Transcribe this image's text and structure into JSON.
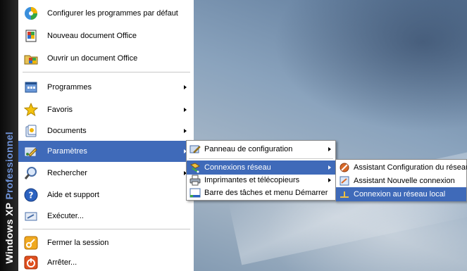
{
  "os_brand": {
    "os_name": "Windows XP",
    "edition": "Professionnel"
  },
  "start_menu": {
    "items": [
      {
        "label": "Configurer les programmes par défaut",
        "icon": "default-programs-icon"
      },
      {
        "label": "Nouveau document Office",
        "icon": "new-office-document-icon"
      },
      {
        "label": "Ouvrir un document Office",
        "icon": "open-office-document-icon"
      },
      {
        "label": "Programmes",
        "icon": "programs-icon"
      },
      {
        "label": "Favoris",
        "icon": "favorites-star-icon"
      },
      {
        "label": "Documents",
        "icon": "documents-icon"
      },
      {
        "label": "Paramètres",
        "icon": "settings-icon"
      },
      {
        "label": "Rechercher",
        "icon": "search-magnifier-icon"
      },
      {
        "label": "Aide et support",
        "icon": "help-icon"
      },
      {
        "label": "Exécuter...",
        "icon": "run-icon"
      },
      {
        "label": "Fermer la session",
        "icon": "logoff-key-icon"
      },
      {
        "label": "Arrêter...",
        "icon": "shutdown-icon"
      }
    ]
  },
  "settings_submenu": {
    "items": [
      {
        "label": "Panneau de configuration",
        "icon": "control-panel-icon"
      },
      {
        "label": "Connexions réseau",
        "icon": "network-connections-icon"
      },
      {
        "label": "Imprimantes et télécopieurs",
        "icon": "printers-icon"
      },
      {
        "label": "Barre des tâches et menu Démarrer",
        "icon": "taskbar-icon"
      }
    ]
  },
  "network_submenu": {
    "items": [
      {
        "label": "Assistant Configuration du réseau",
        "icon": "network-setup-wizard-icon"
      },
      {
        "label": "Assistant Nouvelle connexion",
        "icon": "new-connection-wizard-icon"
      },
      {
        "label": "Connexion au réseau local",
        "icon": "lan-connection-icon"
      }
    ]
  },
  "colors": {
    "highlight": "#3f6ab9",
    "strip": "#111111",
    "brand_accent": "#6f93d8"
  }
}
